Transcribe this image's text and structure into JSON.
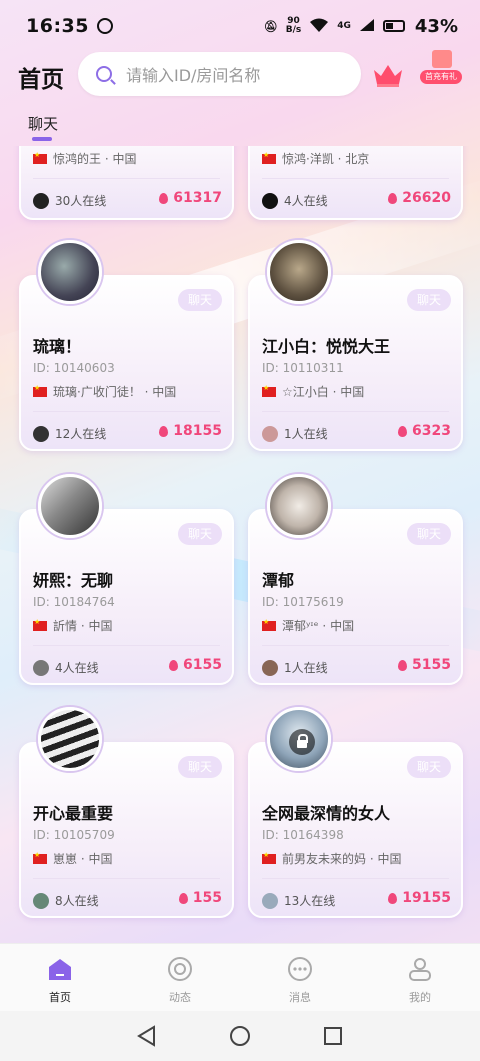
{
  "status": {
    "time": "16:35",
    "net_speed_top": "90",
    "net_speed_bottom": "B/s",
    "signal": "4G",
    "battery": "43%"
  },
  "header": {
    "title": "首页",
    "search_placeholder": "请输入ID/房间名称",
    "gift_label": "首充有礼"
  },
  "tabs": [
    {
      "label": "聊天",
      "active": true
    }
  ],
  "partial_cards": [
    {
      "owner": "惊鸿的王",
      "country": "中国",
      "online": "30人在线",
      "heat": "61317"
    },
    {
      "owner": "惊鸿·洋凯",
      "country": "北京",
      "online": "4人在线",
      "heat": "26620"
    }
  ],
  "cards": [
    {
      "name": "琉璃！",
      "id": "ID: 10140603",
      "owner": "琉璃·广收门徒！",
      "country": "中国",
      "online": "12人在线",
      "heat": "18155",
      "chat": "聊天",
      "locked": false
    },
    {
      "name": "江小白：悦悦大王",
      "id": "ID: 10110311",
      "owner": "☆江小白",
      "country": "中国",
      "online": "1人在线",
      "heat": "6323",
      "chat": "聊天",
      "locked": false
    },
    {
      "name": "妍熙：无聊",
      "id": "ID: 10184764",
      "owner": "訢情",
      "country": "中国",
      "online": "4人在线",
      "heat": "6155",
      "chat": "聊天",
      "locked": false
    },
    {
      "name": "潭郁",
      "id": "ID: 10175619",
      "owner": "潭郁ʸᶦᵉ",
      "country": "中国",
      "online": "1人在线",
      "heat": "5155",
      "chat": "聊天",
      "locked": false
    },
    {
      "name": "开心最重要",
      "id": "ID: 10105709",
      "owner": "崽崽",
      "country": "中国",
      "online": "8人在线",
      "heat": "155",
      "chat": "聊天",
      "locked": false
    },
    {
      "name": "全网最深情的女人",
      "id": "ID: 10164398",
      "owner": "前男友未来的妈",
      "country": "中国",
      "online": "13人在线",
      "heat": "19155",
      "chat": "聊天",
      "locked": true
    }
  ],
  "bottom_nav": [
    {
      "label": "首页",
      "icon": "home-icon",
      "active": true
    },
    {
      "label": "动态",
      "icon": "moments-icon",
      "active": false
    },
    {
      "label": "消息",
      "icon": "message-icon",
      "active": false
    },
    {
      "label": "我的",
      "icon": "profile-icon",
      "active": false
    }
  ],
  "colors": {
    "accent": "#8a63e8",
    "heat": "#f0477b",
    "chat_button": "#ecdff8"
  }
}
